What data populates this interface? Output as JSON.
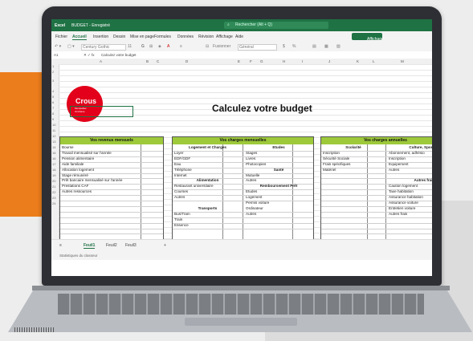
{
  "titlebar": {
    "app": "Excel",
    "doc": "BUDGET - Enregistré",
    "search_placeholder": "Rechercher (Alt + Q)"
  },
  "menu": [
    "Fichier",
    "Accueil",
    "Insertion",
    "Dessin",
    "Mise en page",
    "Formules",
    "Données",
    "Révision",
    "Affichage",
    "Aide"
  ],
  "menu_active": "Accueil",
  "affichage_button": "Affichage",
  "toolbar": {
    "font": "Century Gothic",
    "size": "11",
    "format_table": "Fusionner",
    "number_format": "Général"
  },
  "formula": {
    "namebox": "A1",
    "content": "Calculez votre budget"
  },
  "columns": [
    "A",
    "B",
    "C",
    "D",
    "E",
    "F",
    "G",
    "H",
    "I",
    "J",
    "K",
    "L",
    "M"
  ],
  "rows": [
    "1",
    "2",
    "3",
    "4",
    "5",
    "6",
    "7",
    "8",
    "9",
    "10",
    "11",
    "12",
    "13",
    "14",
    "15",
    "16",
    "17",
    "18",
    "19",
    "20",
    "21",
    "22",
    "23",
    "24"
  ],
  "logo": {
    "name": "Crous",
    "sub1": "Montpellier",
    "sub2": "Occitanie"
  },
  "sheet_title": "Calculez votre budget",
  "revenus": {
    "header": "Vos revenus mensuels",
    "items": [
      "Bourse",
      "Travail mensualisé sur l'année",
      "Pension alimentaire",
      "Aide familiale",
      "Allocation logement",
      "Stage rémunéré",
      "Prêt bancaire mensualisé sur l'année",
      "Prestations CAF",
      "Autres ressources"
    ]
  },
  "charges": {
    "header": "Vos charges mensuelles",
    "col1_title": "Logement et Charges",
    "col1": [
      "Loyer",
      "EDF/GDF",
      "Eau",
      "Téléphone",
      "Internet"
    ],
    "col1b_title": "Alimentation",
    "col1b": [
      "Restaurant universitaire",
      "Courses",
      "Autres"
    ],
    "col1c_title": "Transports",
    "col1c": [
      "Bus/Tram",
      "Train",
      "Essence"
    ],
    "col2_title": "Etudes",
    "col2": [
      "Stages",
      "Livres",
      "Photocopies"
    ],
    "col2b_title": "Santé",
    "col2b": [
      "Mutuelle",
      "Autres"
    ],
    "col2c_title": "Remboursement Prêt",
    "col2c": [
      "Etudes",
      "Logement",
      "Permis voiture",
      "Ordinateur",
      "Autres"
    ]
  },
  "annuelles": {
    "header": "Vos charges annuelles",
    "col1_title": "Scolarité",
    "col1": [
      "Inscription",
      "Sécurité Sociale",
      "Frais spécifiques",
      "Matériel"
    ],
    "col2_title": "Culture, Sport &",
    "col2": [
      "Abonnement, adhésio",
      "Inscription",
      "Equipement",
      "Autres"
    ],
    "col2b_title": "Autres frai",
    "col2b": [
      "Caution logement",
      "Taxe habitation",
      "Assurance habitation",
      "Assurance voiture",
      "Entretien voiture",
      "Autres frais"
    ]
  },
  "sheets": [
    "Feuil1",
    "Feuil2",
    "Feuil3"
  ],
  "active_sheet": "Feuil1",
  "status": "Statistiques du classeur",
  "colors": {
    "excel_green": "#1f7244",
    "section_green": "#9dc93b",
    "crous_red": "#e2001a",
    "orange": "#ec7d1c"
  }
}
